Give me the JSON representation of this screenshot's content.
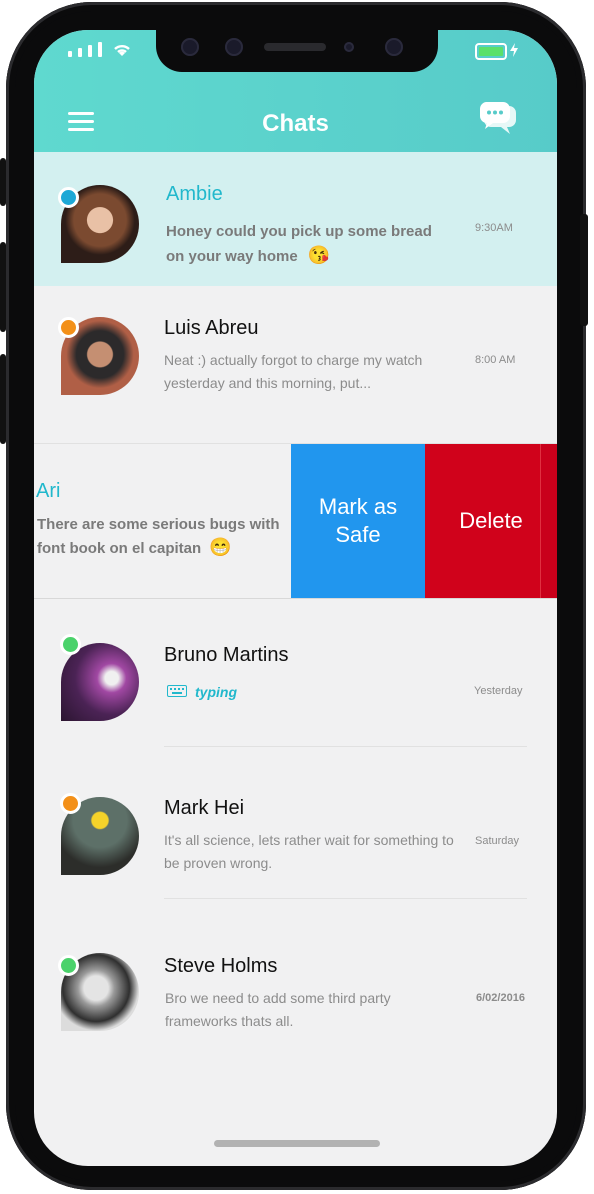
{
  "header": {
    "title": "Chats"
  },
  "actions": {
    "mark_safe_line1": "Mark as",
    "mark_safe_line2": "Safe",
    "delete": "Delete"
  },
  "chats": [
    {
      "name": "Ambie",
      "line1": "Honey could you pick up some bread",
      "line2": "on your way home",
      "emoji": "😘",
      "time": "9:30AM",
      "status_color": "#1da8d6",
      "highlighted": true
    },
    {
      "name": "Luis Abreu",
      "line1": "Neat :) actually forgot to charge my watch",
      "line2": "yesterday and this morning, put...",
      "time": "8:00 AM",
      "status_color": "#f39019"
    },
    {
      "name": "Ari",
      "line1": "There are some serious bugs with",
      "line2": "font book on el capitan",
      "emoji": "😁",
      "swiped": true
    },
    {
      "name": "Bruno Martins",
      "typing": "typing",
      "time": "Yesterday",
      "status_color": "#4bd26b"
    },
    {
      "name": "Mark Hei",
      "line1": "It's all science, lets rather wait for something to",
      "line2": "be proven wrong.",
      "time": "Saturday",
      "status_color": "#f39019"
    },
    {
      "name": "Steve Holms",
      "line1": "Bro we need to add some third party",
      "line2": "frameworks thats all.",
      "time": "6/02/2016",
      "status_color": "#4bd26b"
    }
  ],
  "colors": {
    "header": "#5dd6cd",
    "accent": "#21b8cc",
    "mark_safe": "#2196ee",
    "delete": "#d0021b"
  }
}
